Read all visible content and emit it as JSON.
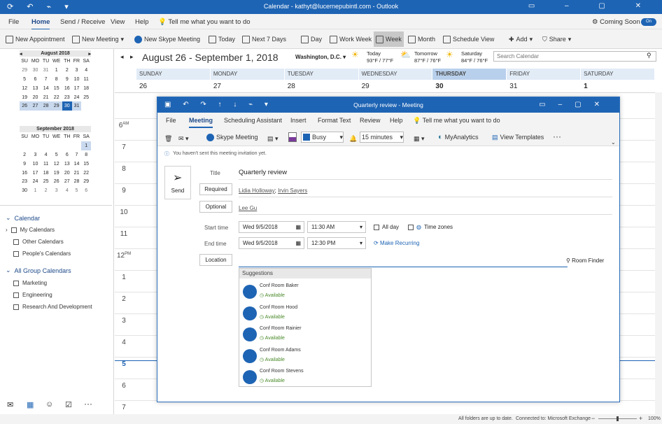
{
  "window": {
    "title": "Calendar - kathyt@lucernepubintl.com - Outlook"
  },
  "menu": {
    "file": "File",
    "home": "Home",
    "send_receive": "Send / Receive",
    "view": "View",
    "help": "Help",
    "tell_me": "Tell me what you want to do",
    "coming_soon": "Coming Soon",
    "toggle": "On"
  },
  "ribbon": {
    "new_appointment": "New Appointment",
    "new_meeting": "New Meeting",
    "new_skype": "New Skype Meeting",
    "today": "Today",
    "next7": "Next 7 Days",
    "day": "Day",
    "work_week": "Work Week",
    "week": "Week",
    "month": "Month",
    "schedule_view": "Schedule View",
    "add": "Add",
    "share": "Share"
  },
  "mini1": {
    "title": "August 2018",
    "days": [
      "SU",
      "MO",
      "TU",
      "WE",
      "TH",
      "FR",
      "SA"
    ],
    "weeks": [
      [
        "29",
        "30",
        "31",
        "1",
        "2",
        "3",
        "4"
      ],
      [
        "5",
        "6",
        "7",
        "8",
        "9",
        "10",
        "11"
      ],
      [
        "12",
        "13",
        "14",
        "15",
        "16",
        "17",
        "18"
      ],
      [
        "19",
        "20",
        "21",
        "22",
        "23",
        "24",
        "25"
      ],
      [
        "26",
        "27",
        "28",
        "29",
        "30",
        "31",
        ""
      ]
    ]
  },
  "mini2": {
    "title": "September 2018",
    "days": [
      "SU",
      "MO",
      "TU",
      "WE",
      "TH",
      "FR",
      "SA"
    ],
    "weeks": [
      [
        "",
        "",
        "",
        "",
        "",
        "",
        "1"
      ],
      [
        "2",
        "3",
        "4",
        "5",
        "6",
        "7",
        "8"
      ],
      [
        "9",
        "10",
        "11",
        "12",
        "13",
        "14",
        "15"
      ],
      [
        "16",
        "17",
        "18",
        "19",
        "20",
        "21",
        "22"
      ],
      [
        "23",
        "24",
        "25",
        "26",
        "27",
        "28",
        "29"
      ],
      [
        "30",
        "1",
        "2",
        "3",
        "4",
        "5",
        "6"
      ]
    ]
  },
  "leftnav": {
    "calendar": "Calendar",
    "my_calendars": "My Calendars",
    "other_calendars": "Other Calendars",
    "peoples_calendars": "People's Calendars",
    "all_group": "All Group Calendars",
    "marketing": "Marketing",
    "engineering": "Engineering",
    "rnd": "Research And Development"
  },
  "calendar": {
    "range": "August 26 - September 1, 2018",
    "location": "Washington, D.C.",
    "search_placeholder": "Search Calendar",
    "weather": [
      {
        "day": "Today",
        "temp": "93°F / 77°F"
      },
      {
        "day": "Tomorrow",
        "temp": "87°F / 76°F"
      },
      {
        "day": "Saturday",
        "temp": "84°F / 76°F"
      }
    ],
    "days": [
      {
        "name": "SUNDAY",
        "num": "26"
      },
      {
        "name": "MONDAY",
        "num": "27"
      },
      {
        "name": "TUESDAY",
        "num": "28"
      },
      {
        "name": "WEDNESDAY",
        "num": "29"
      },
      {
        "name": "THURSDAY",
        "num": "30"
      },
      {
        "name": "FRIDAY",
        "num": "31"
      },
      {
        "name": "SATURDAY",
        "num": "1"
      }
    ],
    "hours": [
      "6",
      "AM",
      "7",
      "8",
      "9",
      "10",
      "11",
      "12",
      "PM",
      "1",
      "2",
      "3",
      "4",
      "5",
      "6",
      "7"
    ]
  },
  "meeting": {
    "title": "Quarterly review - Meeting",
    "tabs": {
      "file": "File",
      "meeting": "Meeting",
      "scheduling": "Scheduling Assistant",
      "insert": "Insert",
      "format": "Format Text",
      "review": "Review",
      "help": "Help",
      "tell_me": "Tell me what you want to do"
    },
    "ribbon": {
      "skype": "Skype Meeting",
      "busy": "Busy",
      "reminder": "15 minutes",
      "analytics": "MyAnalytics",
      "templates": "View Templates",
      "more": "···"
    },
    "info": "You haven't sent this meeting invitation yet.",
    "send": "Send",
    "labels": {
      "title": "Title",
      "required": "Required",
      "optional": "Optional",
      "start": "Start time",
      "end": "End time",
      "location": "Location"
    },
    "values": {
      "title": "Quarterly review",
      "required1": "Lidia Holloway",
      "required_sep": ";",
      "required2": "Irvin Sayers",
      "optional": "Lee Gu",
      "start_date": "Wed 9/5/2018",
      "start_time": "11:30 AM",
      "end_date": "Wed 9/5/2018",
      "end_time": "12:30 PM",
      "all_day": "All day",
      "time_zones": "Time zones",
      "make_recurring": "Make Recurring",
      "room_finder": "Room Finder"
    },
    "suggestions_title": "Suggestions",
    "rooms": [
      {
        "name": "Conf Room Baker",
        "status": "Available"
      },
      {
        "name": "Conf Room Hood",
        "status": "Available"
      },
      {
        "name": "Conf Room Rainier",
        "status": "Available"
      },
      {
        "name": "Conf Room Adams",
        "status": "Available"
      },
      {
        "name": "Conf Room Stevens",
        "status": "Available"
      }
    ]
  },
  "status": {
    "left": "All folders are up to date.",
    "right": "Connected to: Microsoft Exchange",
    "zoom": "100%"
  }
}
